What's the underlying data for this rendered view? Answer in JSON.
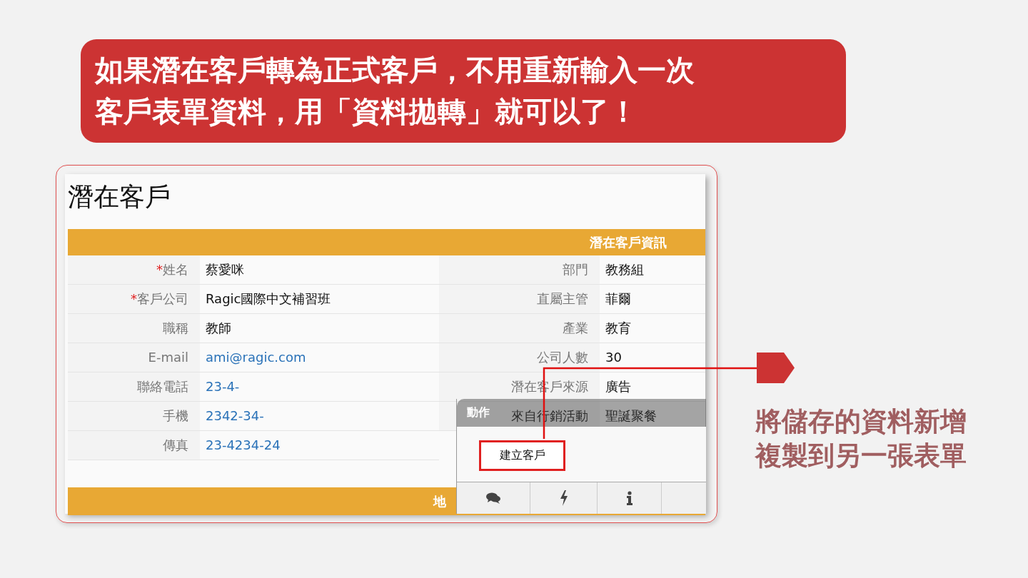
{
  "banner": {
    "lines": [
      "如果潛在客戶轉為正式客戶，不用重新輸入一次",
      "客戶表單資料，用「資料拋轉」就可以了！"
    ]
  },
  "form": {
    "title": "潛在客戶",
    "section_header": "潛在客戶資訊",
    "left_fields": [
      {
        "mark": "*",
        "label": "姓名",
        "value": "蔡愛咪",
        "kind": "text"
      },
      {
        "mark": "*",
        "label": "客戶公司",
        "value": "Ragic國際中文補習班",
        "kind": "text"
      },
      {
        "label": "職稱",
        "value": "教師",
        "kind": "text"
      },
      {
        "label": "E-mail",
        "value": "ami@ragic.com",
        "kind": "link"
      },
      {
        "label": "聯絡電話",
        "value": "23-4-",
        "kind": "link"
      },
      {
        "label": "手機",
        "value": "2342-34-",
        "kind": "link"
      },
      {
        "label": "傳真",
        "value": "23-4234-24",
        "kind": "link"
      }
    ],
    "right_fields": [
      {
        "label": "部門",
        "value": "教務組",
        "kind": "text"
      },
      {
        "label": "直屬主管",
        "value": "菲爾",
        "kind": "text"
      },
      {
        "label": "產業",
        "value": "教育",
        "kind": "text"
      },
      {
        "label": "公司人數",
        "value": "30",
        "kind": "text"
      },
      {
        "label": "潛在客戶來源",
        "value": "廣告",
        "kind": "text"
      },
      {
        "label": "來自行銷活動",
        "value": "聖誕聚餐",
        "kind": "text"
      }
    ],
    "next_section_header": "地"
  },
  "action_panel": {
    "title": "動作",
    "buttons": [
      {
        "label": "建立客戶",
        "highlighted": true
      }
    ],
    "toolbar": [
      {
        "kind": "comments"
      },
      {
        "kind": "bolt"
      },
      {
        "kind": "info"
      },
      {
        "kind": "empty"
      }
    ]
  },
  "callout": {
    "lines": [
      "將儲存的資料新增",
      "複製到另一張表單"
    ]
  }
}
